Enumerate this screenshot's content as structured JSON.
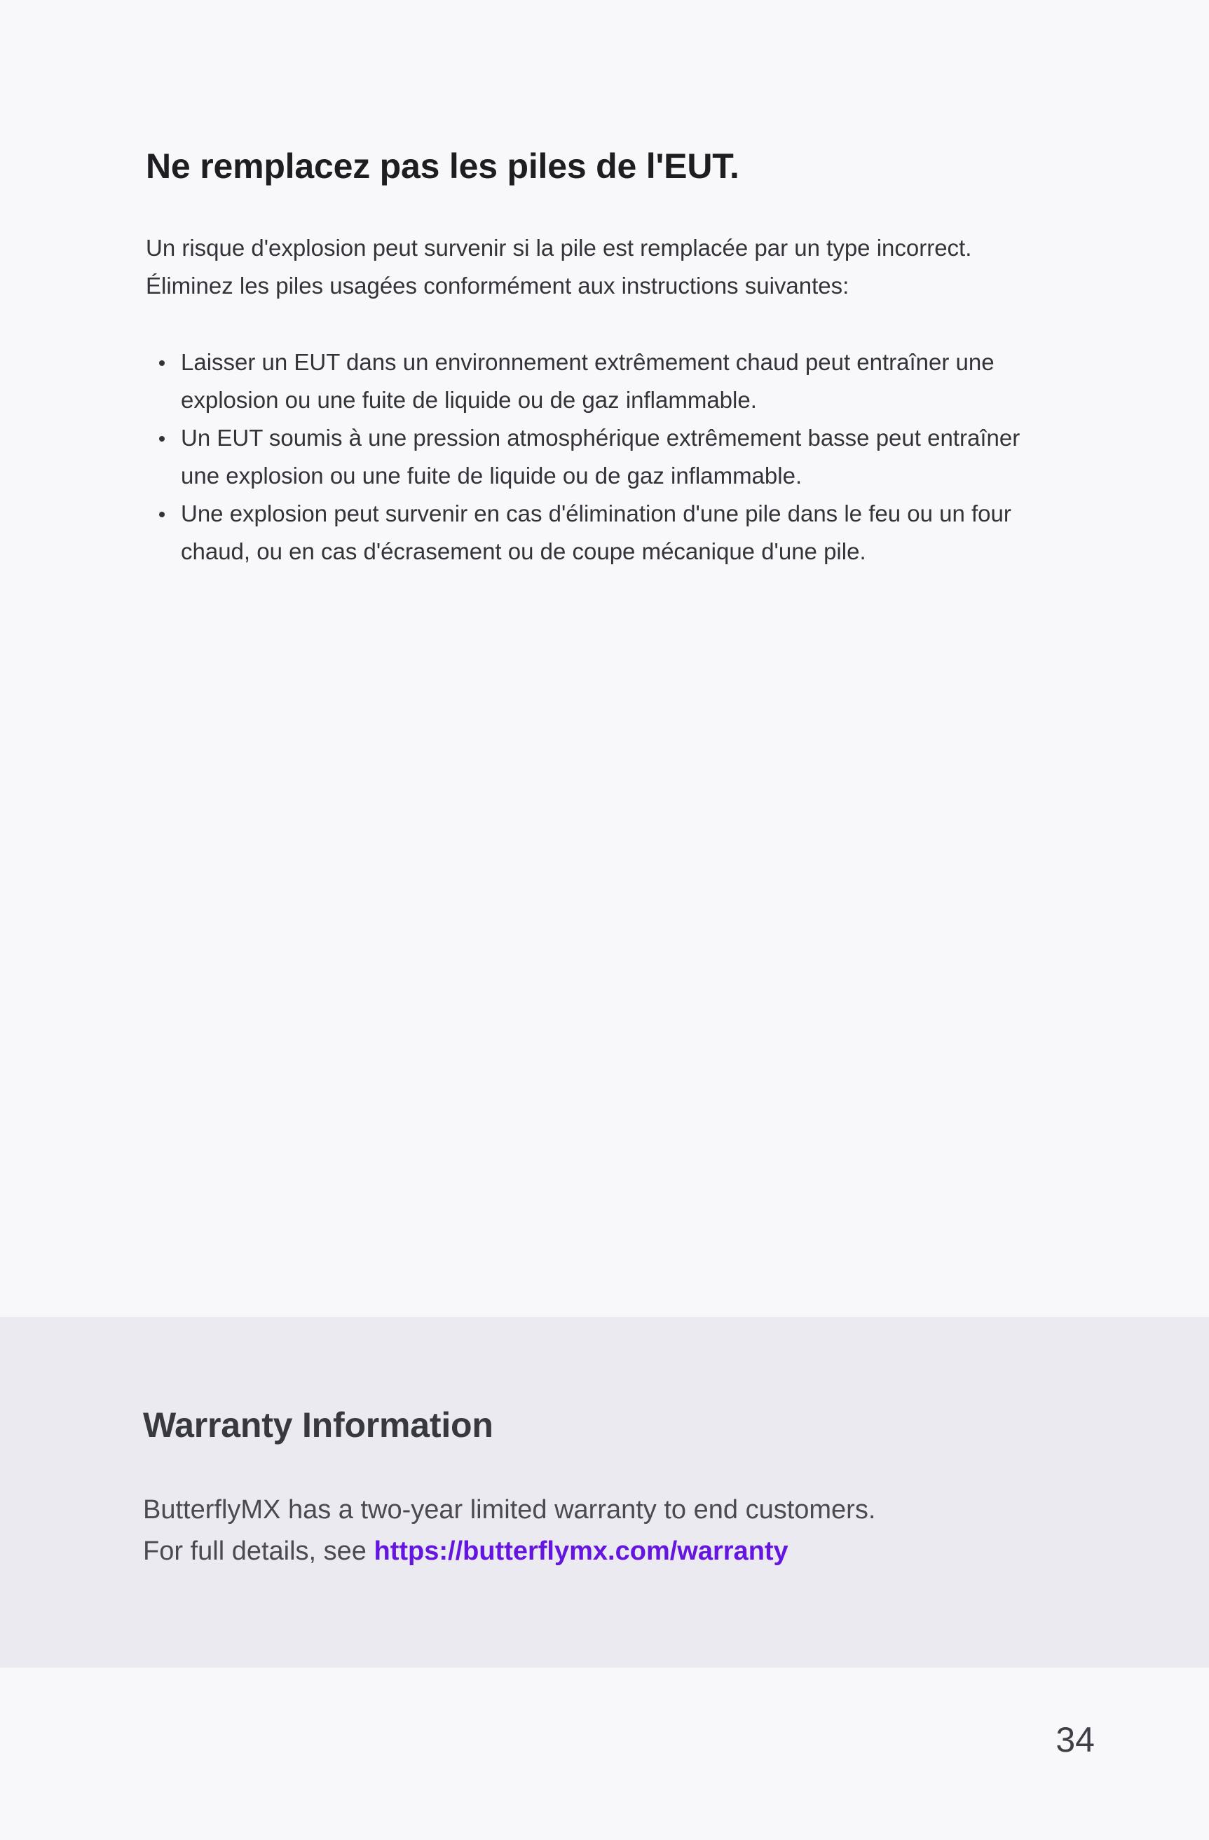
{
  "main": {
    "title": "Ne remplacez pas les piles de l'EUT.",
    "intro_lines": [
      "Un risque d'explosion peut survenir si la pile est remplacée par un type incorrect.",
      "Éliminez les piles usagées conformément aux instructions suivantes:"
    ],
    "bullets": [
      {
        "lines": [
          "Laisser un EUT dans un environnement extrêmement chaud peut entraîner une",
          "explosion ou une fuite de liquide ou de gaz inflammable."
        ]
      },
      {
        "lines": [
          "Un EUT soumis à une pression atmosphérique extrêmement basse peut entraîner",
          "une explosion ou une fuite de liquide ou de gaz inflammable."
        ]
      },
      {
        "lines": [
          "Une explosion peut survenir en cas d'élimination d'une pile dans le feu ou un four",
          "chaud, ou en cas d'écrasement ou de coupe mécanique d'une pile."
        ]
      }
    ]
  },
  "warranty": {
    "title": "Warranty Information",
    "line1": "ButterflyMX has a two-year limited warranty to end customers.",
    "line2_prefix": "For full details, see ",
    "link_text": "https://butterflymx.com/warranty",
    "link_color": "#6416e0",
    "background_color": "#ebeaf0"
  },
  "footer": {
    "page_number": "34"
  }
}
